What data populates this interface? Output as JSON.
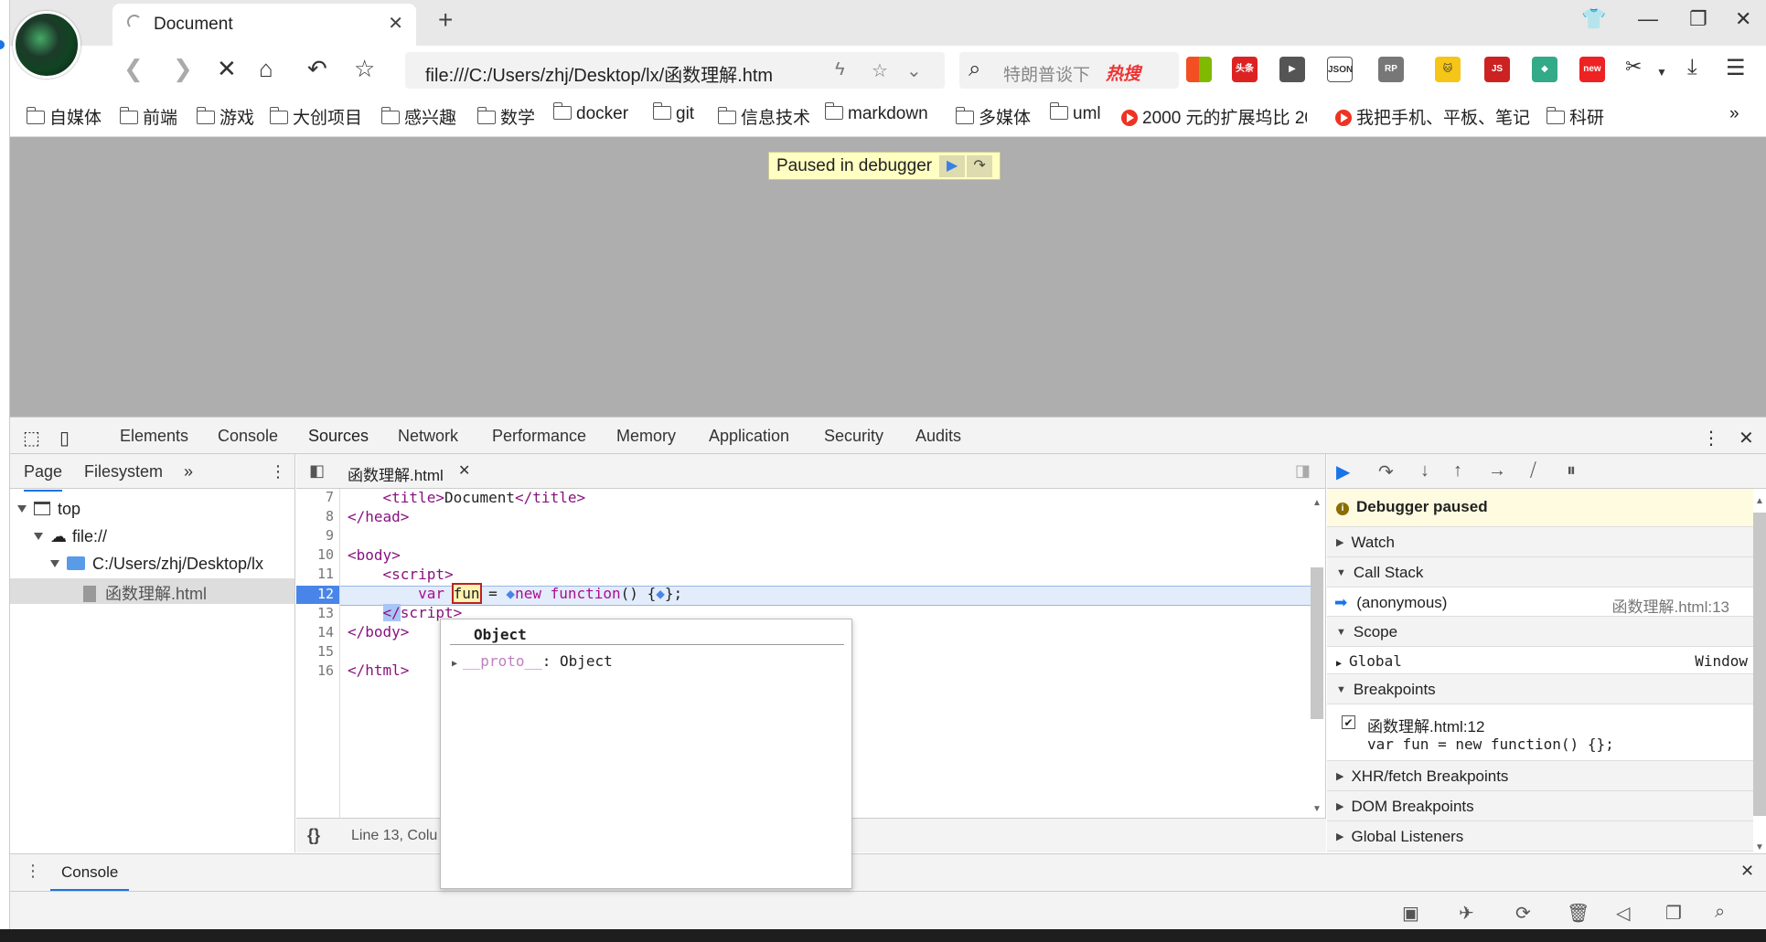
{
  "browser": {
    "tab_title": "Document",
    "url": "file:///C:/Users/zhj/Desktop/lx/函数理解.htm",
    "search_placeholder": "特朗普谈下",
    "search_hot": "热搜",
    "extensions": [
      "windows-logo",
      "头条",
      "video",
      "JSON",
      "RP",
      "cat",
      "JS",
      "layers",
      "new"
    ]
  },
  "bookmarks": [
    {
      "label": "自媒体",
      "icon": "folder-icon"
    },
    {
      "label": "前端",
      "icon": "folder-icon"
    },
    {
      "label": "游戏",
      "icon": "folder-icon"
    },
    {
      "label": "大创项目",
      "icon": "folder-icon"
    },
    {
      "label": "感兴趣",
      "icon": "folder-icon"
    },
    {
      "label": "数学",
      "icon": "folder-icon"
    },
    {
      "label": "docker",
      "icon": "folder-icon"
    },
    {
      "label": "git",
      "icon": "folder-icon"
    },
    {
      "label": "信息技术",
      "icon": "folder-icon"
    },
    {
      "label": "markdown",
      "icon": "folder-icon"
    },
    {
      "label": "多媒体",
      "icon": "folder-icon"
    },
    {
      "label": "uml",
      "icon": "folder-icon"
    },
    {
      "label": "2000 元的扩展坞比 20",
      "icon": "video-icon"
    },
    {
      "label": "我把手机、平板、笔记",
      "icon": "video-icon"
    },
    {
      "label": "科研",
      "icon": "folder-icon"
    }
  ],
  "overlay": {
    "paused_text": "Paused in debugger"
  },
  "devtools": {
    "tabs": [
      "Elements",
      "Console",
      "Sources",
      "Network",
      "Performance",
      "Memory",
      "Application",
      "Security",
      "Audits"
    ],
    "active_tab": "Sources",
    "navigator": {
      "tabs": [
        "Page",
        "Filesystem"
      ],
      "tree": [
        "top",
        "file://",
        "C:/Users/zhj/Desktop/lx",
        "函数理解.html"
      ]
    },
    "editor": {
      "file_tab": "函数理解.html",
      "line_numbers": [
        "7",
        "8",
        "9",
        "10",
        "11",
        "12",
        "13",
        "14",
        "15",
        "16"
      ],
      "status": "Line 13, Colu"
    },
    "popover": {
      "title": "Object",
      "proto_key": "__proto__",
      "proto_value": ": Object"
    },
    "sidebar": {
      "debugger_paused": "Debugger paused",
      "watch": "Watch",
      "call_stack": "Call Stack",
      "frame_name": "(anonymous)",
      "frame_loc": "函数理解.html:13",
      "scope": "Scope",
      "global": "Global",
      "global_value": "Window",
      "breakpoints": "Breakpoints",
      "bp_location": "函数理解.html:12",
      "bp_code": "var fun = new function() {};",
      "xhr": "XHR/fetch Breakpoints",
      "dom": "DOM Breakpoints",
      "listeners": "Global Listeners"
    },
    "drawer": {
      "tab": "Console"
    }
  }
}
